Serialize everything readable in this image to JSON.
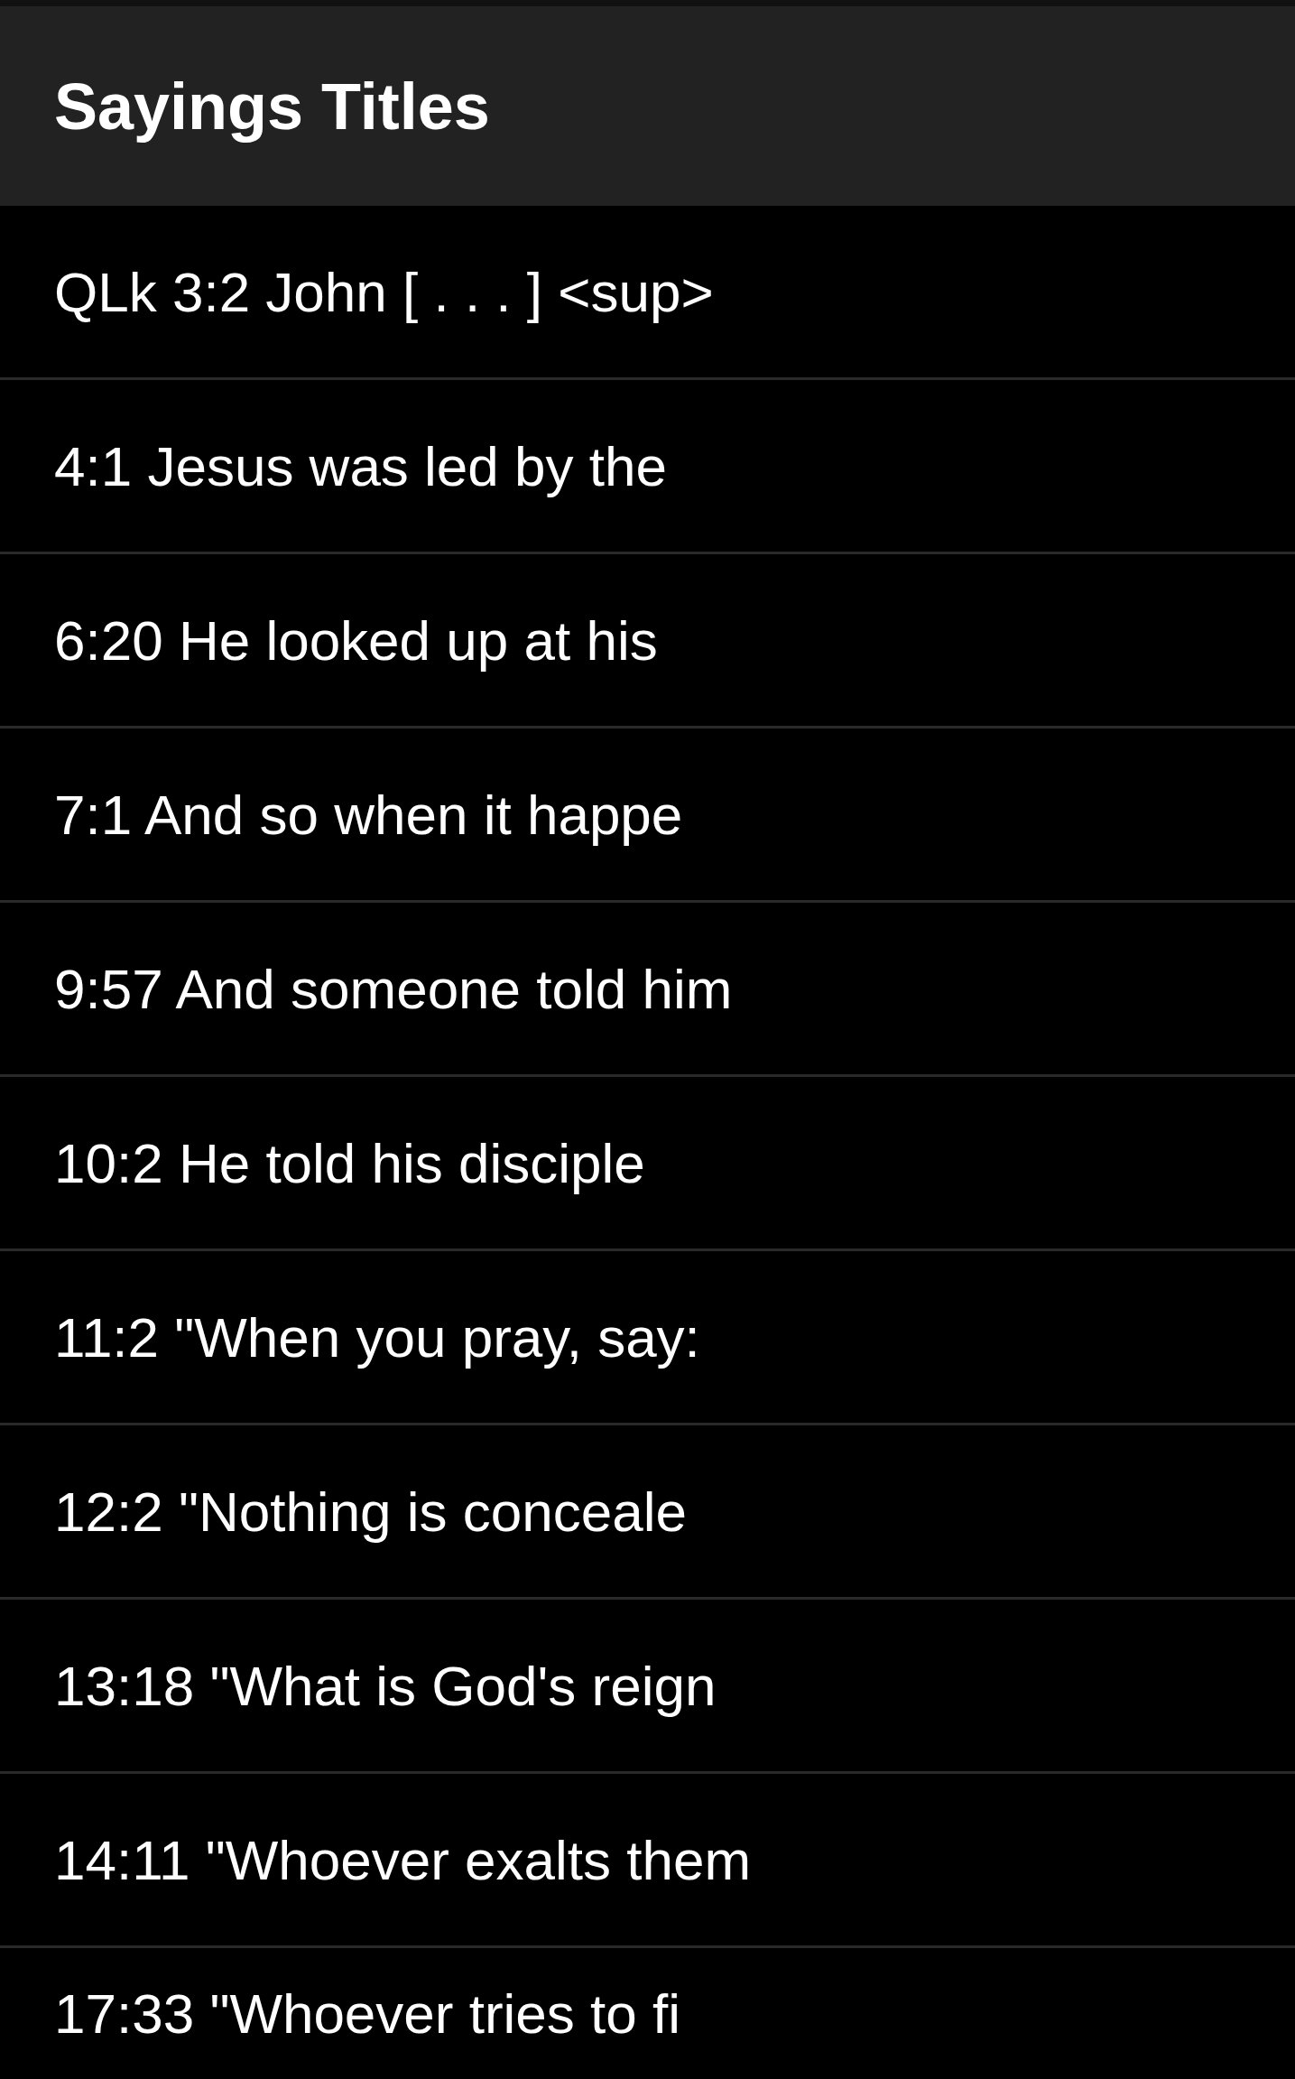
{
  "header": {
    "title": "Sayings Titles"
  },
  "items": [
    {
      "label": "QLk 3:2 John [ . . . ] <sup>"
    },
    {
      "label": "4:1 Jesus was led by the"
    },
    {
      "label": "6:20 He looked up at his"
    },
    {
      "label": "7:1 And so when it happe"
    },
    {
      "label": "9:57 And someone told him"
    },
    {
      "label": "10:2 He told his disciple"
    },
    {
      "label": "11:2 \"When you pray, say:"
    },
    {
      "label": "12:2 \"Nothing is conceale"
    },
    {
      "label": "13:18 \"What is God's reign"
    },
    {
      "label": "14:11 \"Whoever exalts them"
    },
    {
      "label": "17:33 \"Whoever tries to fi"
    }
  ]
}
